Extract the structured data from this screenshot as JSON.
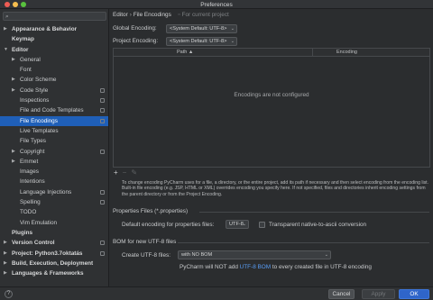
{
  "window": {
    "title": "Preferences"
  },
  "search": {
    "placeholder": ""
  },
  "sidebar": {
    "items": [
      {
        "label": "Appearance & Behavior",
        "arrow": "▶",
        "bold": true
      },
      {
        "label": "Keymap",
        "arrow": "",
        "bold": true
      },
      {
        "label": "Editor",
        "arrow": "▼",
        "bold": true
      },
      {
        "label": "General",
        "arrow": "▶"
      },
      {
        "label": "Font",
        "arrow": ""
      },
      {
        "label": "Color Scheme",
        "arrow": "▶"
      },
      {
        "label": "Code Style",
        "arrow": "▶",
        "page": true
      },
      {
        "label": "Inspections",
        "arrow": "",
        "page": true
      },
      {
        "label": "File and Code Templates",
        "arrow": "",
        "page": true
      },
      {
        "label": "File Encodings",
        "arrow": "",
        "page": true,
        "selected": true
      },
      {
        "label": "Live Templates",
        "arrow": ""
      },
      {
        "label": "File Types",
        "arrow": ""
      },
      {
        "label": "Copyright",
        "arrow": "▶",
        "page": true
      },
      {
        "label": "Emmet",
        "arrow": "▶"
      },
      {
        "label": "Images",
        "arrow": ""
      },
      {
        "label": "Intentions",
        "arrow": ""
      },
      {
        "label": "Language Injections",
        "arrow": "",
        "page": true
      },
      {
        "label": "Spelling",
        "arrow": "",
        "page": true
      },
      {
        "label": "TODO",
        "arrow": ""
      },
      {
        "label": "Vim Emulation",
        "arrow": ""
      },
      {
        "label": "Plugins",
        "arrow": "",
        "bold": true
      },
      {
        "label": "Version Control",
        "arrow": "▶",
        "bold": true,
        "page": true
      },
      {
        "label": "Project: Python3.7oktatás",
        "arrow": "▶",
        "bold": true,
        "page": true
      },
      {
        "label": "Build, Execution, Deployment",
        "arrow": "▶",
        "bold": true
      },
      {
        "label": "Languages & Frameworks",
        "arrow": "▶",
        "bold": true
      }
    ]
  },
  "breadcrumb": {
    "parent": "Editor",
    "separator": "›",
    "current": "File Encodings",
    "scope": "For current project"
  },
  "global_encoding": {
    "label": "Global Encoding:",
    "value": "<System Default: UTF-8>"
  },
  "project_encoding": {
    "label": "Project Encoding:",
    "value": "<System Default: UTF-8>"
  },
  "table": {
    "col_path": "Path",
    "col_encoding": "Encoding",
    "empty_text": "Encodings are not configured",
    "toolbar": {
      "add": "+",
      "remove": "−",
      "edit": "✎"
    }
  },
  "description": "To change encoding PyCharm uses for a file, a directory, or the entire project, add its path if necessary and then select encoding from the encoding list. Built-in file encoding (e.g. JSP, HTML or XML) overrides encoding you specify here. If not specified, files and directories inherit encoding settings from the parent directory or from the Project Encoding.",
  "properties": {
    "section": "Properties Files (*.properties)",
    "default_label": "Default encoding for properties files:",
    "default_value": "UTF-8",
    "transparent_label": "Transparent native-to-ascii conversion"
  },
  "bom": {
    "section": "BOM for new UTF-8 files",
    "create_label": "Create UTF-8 files:",
    "create_value": "with NO BOM",
    "info_prefix": "PyCharm will NOT add",
    "info_link": "UTF-8 BOM",
    "info_suffix": "to every created file in UTF-8 encoding"
  },
  "buttons": {
    "help": "?",
    "cancel": "Cancel",
    "apply": "Apply",
    "ok": "OK"
  },
  "icons": {
    "search": "search-icon",
    "arrow_collapsed": "chevron-right-icon",
    "arrow_expanded": "chevron-down-icon",
    "project_scope": "page-icon",
    "combo": "chevron-down-icon"
  },
  "colors": {
    "selection": "#1f5fb8",
    "link": "#589df6",
    "primary_button": "#2f65ca"
  }
}
